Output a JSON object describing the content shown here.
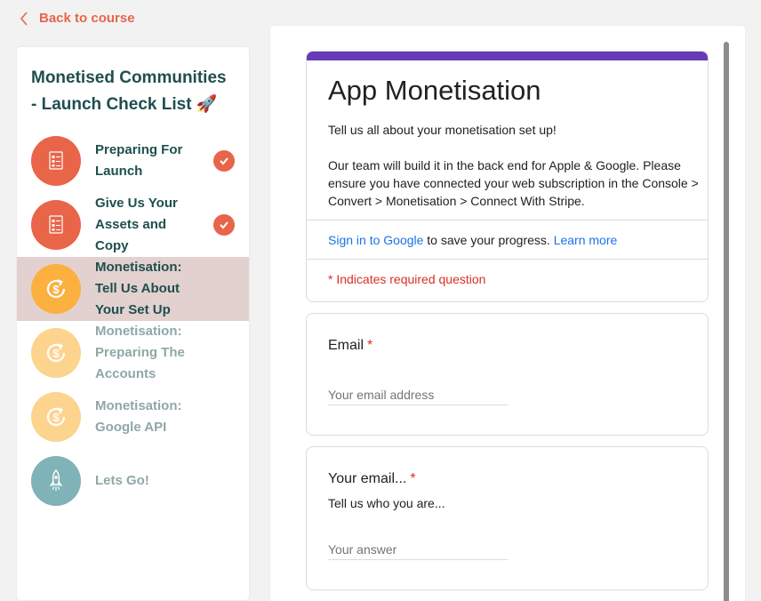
{
  "nav": {
    "back_label": "Back to course"
  },
  "course": {
    "title": "Monetised Communities - Launch Check List",
    "title_emoji": "🚀"
  },
  "lessons": [
    {
      "label": "Preparing For Launch",
      "completed": true,
      "icon": "checklist-icon",
      "color": "#e8654a",
      "state": "done"
    },
    {
      "label": "Give Us Your Assets and Copy",
      "completed": true,
      "icon": "checklist-icon",
      "color": "#e8654a",
      "state": "done"
    },
    {
      "label": "Monetisation: Tell Us About Your Set Up",
      "completed": false,
      "icon": "dollar-refresh-icon",
      "color": "#fbb040",
      "state": "active"
    },
    {
      "label": "Monetisation: Preparing The Accounts",
      "completed": false,
      "icon": "dollar-refresh-icon",
      "color": "#fdd48e",
      "state": "upcoming"
    },
    {
      "label": "Monetisation: Google API",
      "completed": false,
      "icon": "dollar-refresh-icon",
      "color": "#fdd48e",
      "state": "upcoming"
    },
    {
      "label": "Lets Go!",
      "completed": false,
      "icon": "rocket-icon",
      "color": "#7fb3b8",
      "state": "upcoming"
    }
  ],
  "form": {
    "title": "App Monetisation",
    "description": "Tell us all about your monetisation set up!\n\nOur team will build it in the back end for Apple & Google. Please ensure you have connected your web subscription in the Console > Convert > Monetisation > Connect With Stripe.",
    "signin_link": "Sign in to Google",
    "signin_text": " to save your progress. ",
    "learn_more": "Learn more",
    "required_note": "* Indicates required question",
    "accent_color": "#673ab7",
    "questions": [
      {
        "title": "Email",
        "required_mark": "*",
        "subtitle": "",
        "placeholder": "Your email address"
      },
      {
        "title": "Your email...",
        "required_mark": "*",
        "subtitle": "Tell us who you are...",
        "placeholder": "Your answer"
      }
    ]
  }
}
